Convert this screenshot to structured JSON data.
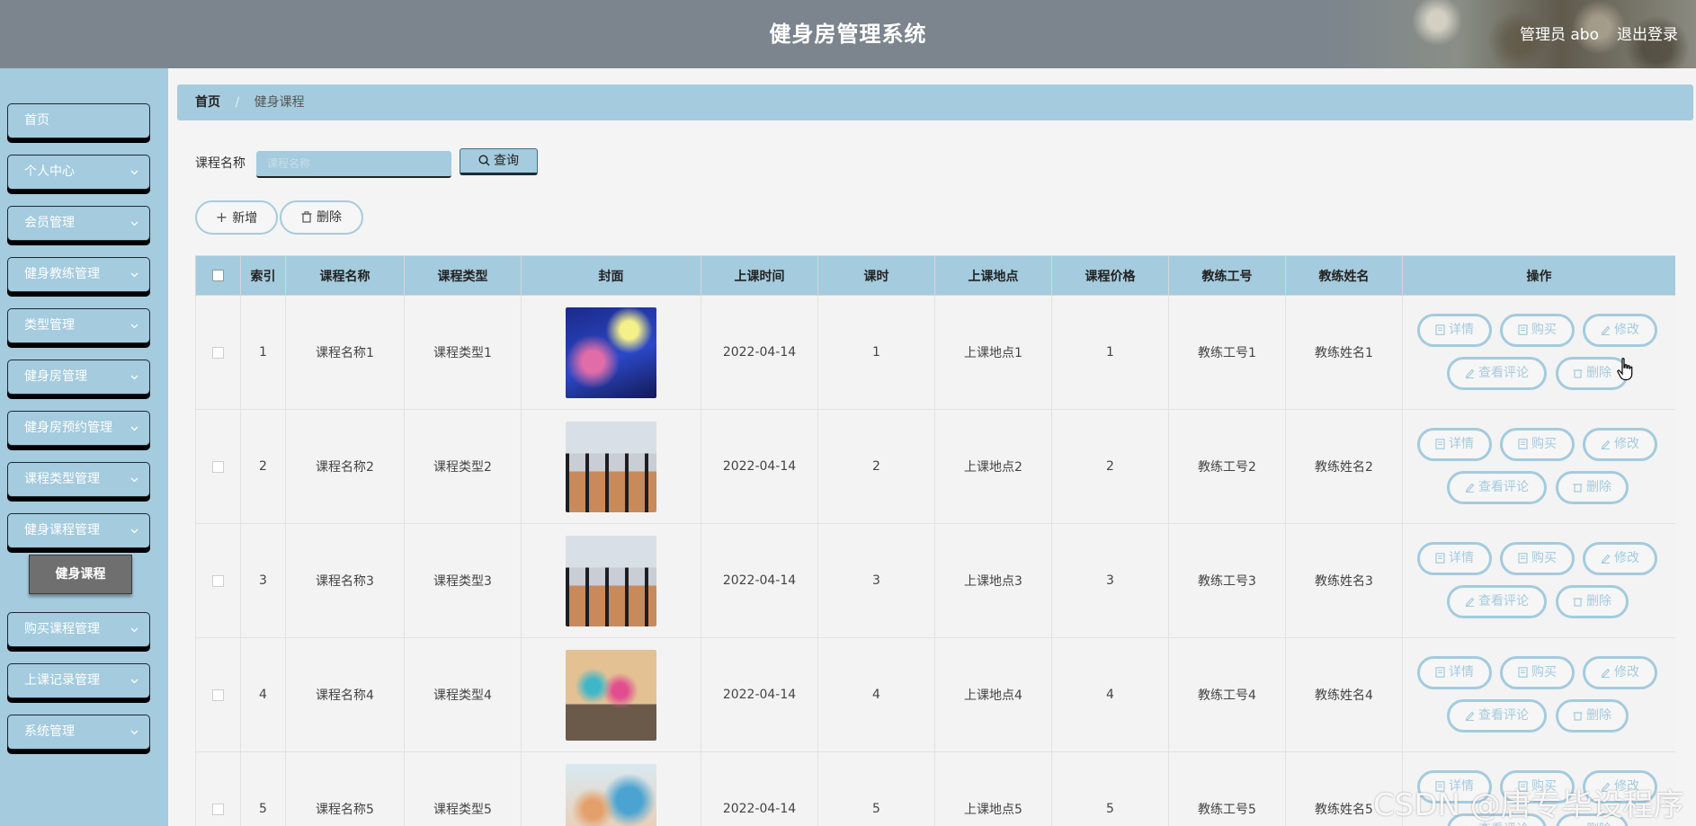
{
  "header": {
    "title": "健身房管理系统",
    "admin": "管理员 abo",
    "logout": "退出登录"
  },
  "sidebar": {
    "items": [
      {
        "label": "首页",
        "has_chevron": false
      },
      {
        "label": "个人中心",
        "has_chevron": true
      },
      {
        "label": "会员管理",
        "has_chevron": true
      },
      {
        "label": "健身教练管理",
        "has_chevron": true
      },
      {
        "label": "类型管理",
        "has_chevron": true
      },
      {
        "label": "健身房管理",
        "has_chevron": true
      },
      {
        "label": "健身房预约管理",
        "has_chevron": true
      },
      {
        "label": "课程类型管理",
        "has_chevron": true
      },
      {
        "label": "健身课程管理",
        "has_chevron": true
      },
      {
        "label": "购买课程管理",
        "has_chevron": true
      },
      {
        "label": "上课记录管理",
        "has_chevron": true
      },
      {
        "label": "系统管理",
        "has_chevron": true
      }
    ],
    "active_sub": "健身课程"
  },
  "breadcrumb": {
    "home": "首页",
    "separator": "/",
    "current": "健身课程"
  },
  "search": {
    "label": "课程名称",
    "placeholder": "课程名称",
    "value": "",
    "button": "查询"
  },
  "actions": {
    "add": "新增",
    "delete": "删除"
  },
  "table": {
    "headers": [
      "索引",
      "课程名称",
      "课程类型",
      "封面",
      "上课时间",
      "课时",
      "上课地点",
      "课程价格",
      "教练工号",
      "教练姓名",
      "操作"
    ],
    "rows": [
      {
        "index": "1",
        "name": "课程名称1",
        "type": "课程类型1",
        "cover": "spin-class",
        "time": "2022-04-14",
        "hours": "1",
        "location": "上课地点1",
        "price": "1",
        "coach_id": "教练工号1",
        "coach_name": "教练姓名1"
      },
      {
        "index": "2",
        "name": "课程名称2",
        "type": "课程类型2",
        "cover": "mat-class",
        "time": "2022-04-14",
        "hours": "2",
        "location": "上课地点2",
        "price": "2",
        "coach_id": "教练工号2",
        "coach_name": "教练姓名2"
      },
      {
        "index": "3",
        "name": "课程名称3",
        "type": "课程类型3",
        "cover": "mat-class",
        "time": "2022-04-14",
        "hours": "3",
        "location": "上课地点3",
        "price": "3",
        "coach_id": "教练工号3",
        "coach_name": "教练姓名3"
      },
      {
        "index": "4",
        "name": "课程名称4",
        "type": "课程类型4",
        "cover": "step-class",
        "time": "2022-04-14",
        "hours": "4",
        "location": "上课地点4",
        "price": "4",
        "coach_id": "教练工号4",
        "coach_name": "教练姓名4"
      },
      {
        "index": "5",
        "name": "课程名称5",
        "type": "课程类型5",
        "cover": "yoga-class",
        "time": "2022-04-14",
        "hours": "5",
        "location": "上课地点5",
        "price": "5",
        "coach_id": "教练工号5",
        "coach_name": "教练姓名5"
      }
    ],
    "row_actions": {
      "detail": "详情",
      "buy": "购买",
      "edit": "修改",
      "comments": "查看评论",
      "delete": "删除"
    }
  },
  "watermark": "CSDN @唐专毕设程序",
  "colors": {
    "accent": "#a4cbde",
    "header_bg": "#7c858e",
    "active_sub_bg": "#6f6f6f"
  }
}
